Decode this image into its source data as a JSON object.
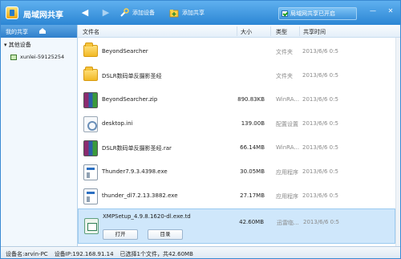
{
  "app": {
    "title": "局域网共享"
  },
  "toolbar": {
    "add_device_label": "添加设备",
    "add_share_label": "添加共享",
    "share_toggle_label": "局域网共享已开启",
    "share_toggle_checked": true
  },
  "sidebar": {
    "header": "我的共享",
    "group_label": "其他设备",
    "devices": [
      {
        "name": "xunlei-59125254"
      }
    ]
  },
  "columns": {
    "name": "文件名",
    "size": "大小",
    "type": "类型",
    "time": "共享时间"
  },
  "files": [
    {
      "name": "BeyondSearcher",
      "size": "",
      "type": "文件夹",
      "time": "2013/6/6 0:5",
      "icon": "folder-icon"
    },
    {
      "name": "DSLR数码单反摄影圣经",
      "size": "",
      "type": "文件夹",
      "time": "2013/6/6 0:5",
      "icon": "folder-icon"
    },
    {
      "name": "BeyondSearcher.zip",
      "size": "890.83KB",
      "type": "WinRA...",
      "time": "2013/6/6 0:5",
      "icon": "rar-icon"
    },
    {
      "name": "desktop.ini",
      "size": "139.00B",
      "type": "配置设置",
      "time": "2013/6/6 0:5",
      "icon": "ini-icon"
    },
    {
      "name": "DSLR数码单反摄影圣经.rar",
      "size": "66.14MB",
      "type": "WinRA...",
      "time": "2013/6/6 0:5",
      "icon": "rar-icon"
    },
    {
      "name": "Thunder7.9.3.4398.exe",
      "size": "30.05MB",
      "type": "应用程序",
      "time": "2013/6/6 0:5",
      "icon": "exe-icon"
    },
    {
      "name": "thunder_dl7.2.13.3882.exe",
      "size": "27.17MB",
      "type": "应用程序",
      "time": "2013/6/6 0:5",
      "icon": "exe-icon"
    },
    {
      "name": "XMPSetup_4.9.8.1620-dl.exe.td",
      "size": "42.60MB",
      "type": "迅雷临...",
      "time": "2013/6/6 0:5",
      "icon": "td-icon"
    }
  ],
  "selected_row": {
    "open_label": "打开",
    "dir_label": "目录"
  },
  "status": {
    "device_name": "设备名:arvin-PC",
    "device_ip": "设备IP:192.168.91.14",
    "selection": "已选择1个文件，共42.60MB"
  }
}
